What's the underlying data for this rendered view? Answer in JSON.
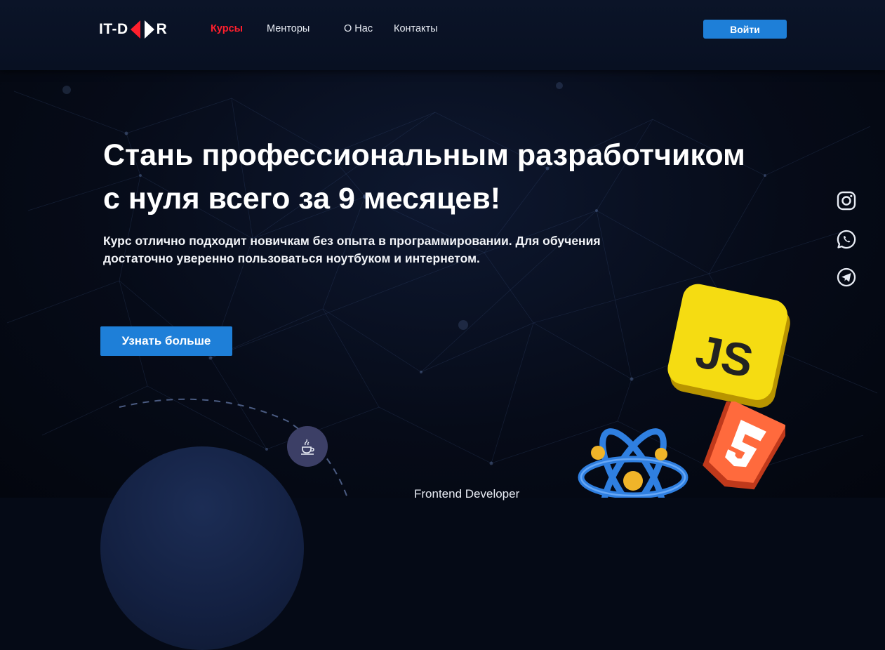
{
  "header": {
    "logo": {
      "left": "IT-D",
      "right": "R"
    },
    "nav": [
      {
        "label": "Курсы",
        "active": true
      },
      {
        "label": "Менторы",
        "active": false
      },
      {
        "label": "О Нас",
        "active": false
      },
      {
        "label": "Контакты",
        "active": false
      }
    ],
    "login_label": "Войти"
  },
  "hero": {
    "title_line1": "Стань профессиональным разработчиком",
    "title_line2": "с нуля всего за 9 месяцев!",
    "subtitle_line1": "Курс отлично подходит новичкам без опыта в программировании. Для обучения",
    "subtitle_line2": "достаточно уверенно пользоваться ноутбуком и интернетом.",
    "cta_label": "Узнать больше"
  },
  "social": [
    "instagram-icon",
    "whatsapp-icon",
    "telegram-icon"
  ],
  "tech_badges": {
    "js_text": "JS"
  },
  "section_preview": {
    "frontend_label": "Frontend Developer"
  },
  "colors": {
    "accent": "#1e7fd8",
    "active_nav": "#ff1f2d",
    "background": "#050a16"
  }
}
